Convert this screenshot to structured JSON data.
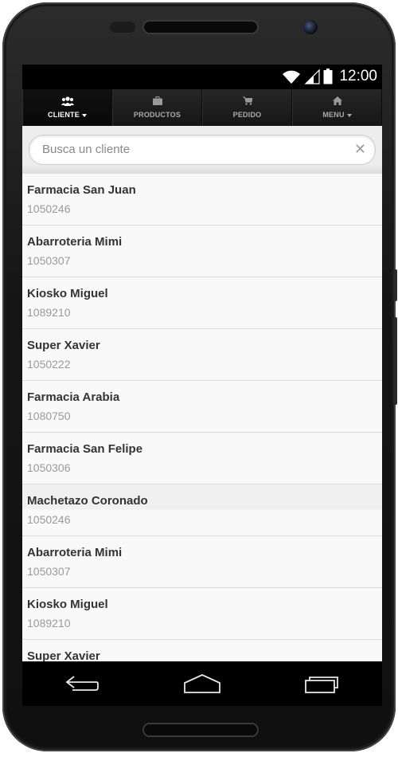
{
  "status_bar": {
    "time": "12:00"
  },
  "nav": {
    "tabs": [
      {
        "label": "CLIENTE",
        "icon": "users-icon",
        "active": true,
        "dropdown": true
      },
      {
        "label": "PRODUCTOS",
        "icon": "briefcase-icon",
        "active": false,
        "dropdown": false
      },
      {
        "label": "PEDIDO",
        "icon": "cart-icon",
        "active": false,
        "dropdown": false
      },
      {
        "label": "MENU",
        "icon": "home-icon",
        "active": false,
        "dropdown": true
      }
    ]
  },
  "search": {
    "placeholder": "Busca un cliente",
    "value": ""
  },
  "clients": [
    {
      "name": "Farmacia San Juan",
      "code": "1050246"
    },
    {
      "name": "Abarroteria Mimi",
      "code": "1050307"
    },
    {
      "name": "Kiosko Miguel",
      "code": "1089210"
    },
    {
      "name": "Super Xavier",
      "code": "1050222"
    },
    {
      "name": "Farmacia Arabia",
      "code": "1080750"
    },
    {
      "name": "Farmacia San Felipe",
      "code": "1050306"
    },
    {
      "name": "Machetazo Coronado",
      "code": "1050246"
    },
    {
      "name": "Abarroteria Mimi",
      "code": "1050307"
    },
    {
      "name": "Kiosko Miguel",
      "code": "1089210"
    },
    {
      "name": "Super Xavier",
      "code": ""
    }
  ],
  "colors": {
    "screen_bg": "#f9f9f9",
    "nav_bg": "#1c1c1c",
    "name_text": "#333333",
    "code_text": "#999999"
  }
}
